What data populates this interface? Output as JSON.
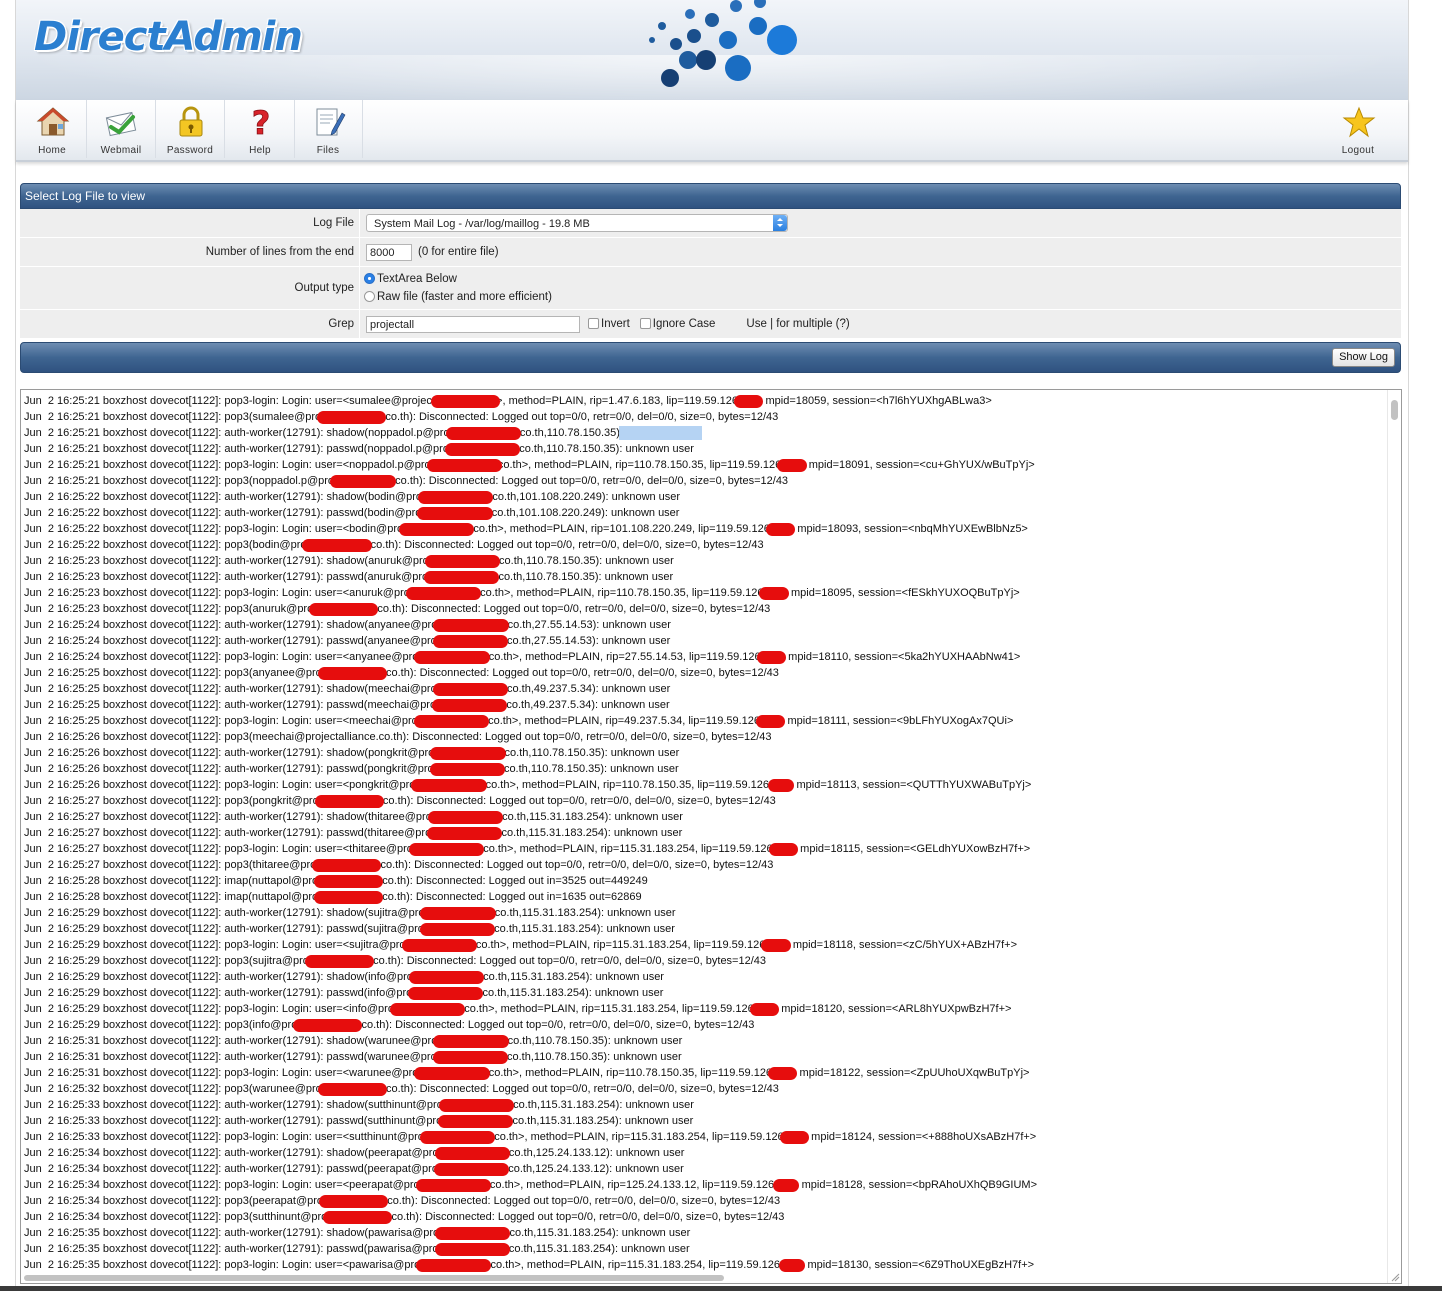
{
  "brand": {
    "logo_text": "DirectAdmin"
  },
  "toolbar": {
    "items": [
      {
        "label": "Home",
        "icon": "home-icon"
      },
      {
        "label": "Webmail",
        "icon": "webmail-icon"
      },
      {
        "label": "Password",
        "icon": "lock-icon"
      },
      {
        "label": "Help",
        "icon": "help-icon"
      },
      {
        "label": "Files",
        "icon": "files-icon"
      }
    ],
    "logout": {
      "label": "Logout",
      "icon": "star-icon"
    }
  },
  "form": {
    "title": "Select Log File to view",
    "log_file_label": "Log File",
    "log_file_value": "System Mail Log - /var/log/maillog - 19.8 MB",
    "lines_label": "Number of lines from the end",
    "lines_value": "8000",
    "lines_hint": "(0 for entire file)",
    "output_label": "Output type",
    "output_option_1": "TextArea Below",
    "output_option_2": "Raw file (faster and more efficient)",
    "output_selected": "TextArea Below",
    "grep_label": "Grep",
    "grep_value": "projectall",
    "invert_label": "Invert",
    "ignore_case_label": "Ignore Case",
    "grep_hint": "Use | for multiple (?)",
    "show_button": "Show Log"
  },
  "colors": {
    "accent_blue": "#3f6591",
    "redaction": "#e60d0d"
  },
  "log_lines": [
    "Jun  2 16:25:21 boxzhost dovecot[1122]: pop3-login: Login: user=<sumalee@project                    >, method=PLAIN, rip=1.47.6.183, lip=119.59.126       , mpid=18059, session=<h7l6hYUXhgABLwa3>",
    "Jun  2 16:25:21 boxzhost dovecot[1122]: pop3(sumalee@pro                    .co.th): Disconnected: Logged out top=0/0, retr=0/0, del=0/0, size=0, bytes=12/43",
    "Jun  2 16:25:21 boxzhost dovecot[1122]: auth-worker(12791): shadow(noppadol.p@pro                      .co.th,110.78.150.35): unknown user",
    "Jun  2 16:25:21 boxzhost dovecot[1122]: auth-worker(12791): passwd(noppadol.p@pro                      .co.th,110.78.150.35): unknown user",
    "Jun  2 16:25:21 boxzhost dovecot[1122]: pop3-login: Login: user=<noppadol.p@pro                      co.th>, method=PLAIN, rip=110.78.150.35, lip=119.59.126       , mpid=18091, session=<cu+GhYUX/wBuTpYj>",
    "Jun  2 16:25:21 boxzhost dovecot[1122]: pop3(noppadol.p@pro                   .co.th): Disconnected: Logged out top=0/0, retr=0/0, del=0/0, size=0, bytes=12/43",
    "Jun  2 16:25:22 boxzhost dovecot[1122]: auth-worker(12791): shadow(bodin@pro                      .co.th,101.108.220.249): unknown user",
    "Jun  2 16:25:22 boxzhost dovecot[1122]: auth-worker(12791): passwd(bodin@pro                      .co.th,101.108.220.249): unknown user",
    "Jun  2 16:25:22 boxzhost dovecot[1122]: pop3-login: Login: user=<bodin@pro                      .co.th>, method=PLAIN, rip=101.108.220.249, lip=119.59.126       , mpid=18093, session=<nbqMhYUXEwBlbNz5>",
    "Jun  2 16:25:22 boxzhost dovecot[1122]: pop3(bodin@pro                    .co.th): Disconnected: Logged out top=0/0, retr=0/0, del=0/0, size=0, bytes=12/43",
    "Jun  2 16:25:23 boxzhost dovecot[1122]: auth-worker(12791): shadow(anuruk@pro                      .co.th,110.78.150.35): unknown user",
    "Jun  2 16:25:23 boxzhost dovecot[1122]: auth-worker(12791): passwd(anuruk@pro                      .co.th,110.78.150.35): unknown user",
    "Jun  2 16:25:23 boxzhost dovecot[1122]: pop3-login: Login: user=<anuruk@pro                      .co.th>, method=PLAIN, rip=110.78.150.35, lip=119.59.126       , mpid=18095, session=<fESkhYUXOQBuTpYj>",
    "Jun  2 16:25:23 boxzhost dovecot[1122]: pop3(anuruk@pro                    .co.th): Disconnected: Logged out top=0/0, retr=0/0, del=0/0, size=0, bytes=12/43",
    "Jun  2 16:25:24 boxzhost dovecot[1122]: auth-worker(12791): shadow(anyanee@pro                      .co.th,27.55.14.53): unknown user",
    "Jun  2 16:25:24 boxzhost dovecot[1122]: auth-worker(12791): passwd(anyanee@pro                      .co.th,27.55.14.53): unknown user",
    "Jun  2 16:25:24 boxzhost dovecot[1122]: pop3-login: Login: user=<anyanee@pro                      .co.th>, method=PLAIN, rip=27.55.14.53, lip=119.59.126       , mpid=18110, session=<5ka2hYUXHAAbNw41>",
    "Jun  2 16:25:25 boxzhost dovecot[1122]: pop3(anyanee@pro                    .co.th): Disconnected: Logged out top=0/0, retr=0/0, del=0/0, size=0, bytes=12/43",
    "Jun  2 16:25:25 boxzhost dovecot[1122]: auth-worker(12791): shadow(meechai@pro                      .co.th,49.237.5.34): unknown user",
    "Jun  2 16:25:25 boxzhost dovecot[1122]: auth-worker(12791): passwd(meechai@pro                      .co.th,49.237.5.34): unknown user",
    "Jun  2 16:25:25 boxzhost dovecot[1122]: pop3-login: Login: user=<meechai@pro                      .co.th>, method=PLAIN, rip=49.237.5.34, lip=119.59.126       , mpid=18111, session=<9bLFhYUXogAx7QUi>",
    "Jun  2 16:25:26 boxzhost dovecot[1122]: pop3(meechai@projectalliance.co.th): Disconnected: Logged out top=0/0, retr=0/0, del=0/0, size=0, bytes=12/43",
    "Jun  2 16:25:26 boxzhost dovecot[1122]: auth-worker(12791): shadow(pongkrit@pro                      .co.th,110.78.150.35): unknown user",
    "Jun  2 16:25:26 boxzhost dovecot[1122]: auth-worker(12791): passwd(pongkrit@pro                      .co.th,110.78.150.35): unknown user",
    "Jun  2 16:25:26 boxzhost dovecot[1122]: pop3-login: Login: user=<pongkrit@pro                      .co.th>, method=PLAIN, rip=110.78.150.35, lip=119.59.126.      , mpid=18113, session=<QUTThYUXWABuTpYj>",
    "Jun  2 16:25:27 boxzhost dovecot[1122]: pop3(pongkrit@pro                    .co.th): Disconnected: Logged out top=0/0, retr=0/0, del=0/0, size=0, bytes=12/43",
    "Jun  2 16:25:27 boxzhost dovecot[1122]: auth-worker(12791): shadow(thitaree@pro                      .co.th,115.31.183.254): unknown user",
    "Jun  2 16:25:27 boxzhost dovecot[1122]: auth-worker(12791): passwd(thitaree@pro                      .co.th,115.31.183.254): unknown user",
    "Jun  2 16:25:27 boxzhost dovecot[1122]: pop3-login: Login: user=<thitaree@pro                      .co.th>, method=PLAIN, rip=115.31.183.254, lip=119.59.126       , mpid=18115, session=<GELdhYUXowBzH7f+>",
    "Jun  2 16:25:27 boxzhost dovecot[1122]: pop3(thitaree@pro                    .co.th): Disconnected: Logged out top=0/0, retr=0/0, del=0/0, size=0, bytes=12/43",
    "Jun  2 16:25:28 boxzhost dovecot[1122]: imap(nuttapol@pro                    .co.th): Disconnected: Logged out in=3525 out=449249",
    "Jun  2 16:25:28 boxzhost dovecot[1122]: imap(nuttapol@pro                    .co.th): Disconnected: Logged out in=1635 out=62869",
    "Jun  2 16:25:29 boxzhost dovecot[1122]: auth-worker(12791): shadow(sujitra@pro                      .co.th,115.31.183.254): unknown user",
    "Jun  2 16:25:29 boxzhost dovecot[1122]: auth-worker(12791): passwd(sujitra@pro                      .co.th,115.31.183.254): unknown user",
    "Jun  2 16:25:29 boxzhost dovecot[1122]: pop3-login: Login: user=<sujitra@pro                      .co.th>, method=PLAIN, rip=115.31.183.254, lip=119.59.126       , mpid=18118, session=<zC/5hYUX+ABzH7f+>",
    "Jun  2 16:25:29 boxzhost dovecot[1122]: pop3(sujitra@pro                    .co.th): Disconnected: Logged out top=0/0, retr=0/0, del=0/0, size=0, bytes=12/43",
    "Jun  2 16:25:29 boxzhost dovecot[1122]: auth-worker(12791): shadow(info@pro                      .co.th,115.31.183.254): unknown user",
    "Jun  2 16:25:29 boxzhost dovecot[1122]: auth-worker(12791): passwd(info@pro                      .co.th,115.31.183.254): unknown user",
    "Jun  2 16:25:29 boxzhost dovecot[1122]: pop3-login: Login: user=<info@pro                      .co.th>, method=PLAIN, rip=115.31.183.254, lip=119.59.126       , mpid=18120, session=<ARL8hYUXpwBzH7f+>",
    "Jun  2 16:25:29 boxzhost dovecot[1122]: pop3(info@pro                    .co.th): Disconnected: Logged out top=0/0, retr=0/0, del=0/0, size=0, bytes=12/43",
    "Jun  2 16:25:31 boxzhost dovecot[1122]: auth-worker(12791): shadow(warunee@pro                      .co.th,110.78.150.35): unknown user",
    "Jun  2 16:25:31 boxzhost dovecot[1122]: auth-worker(12791): passwd(warunee@pro                      .co.th,110.78.150.35): unknown user",
    "Jun  2 16:25:31 boxzhost dovecot[1122]: pop3-login: Login: user=<warunee@pro                      .co.th>, method=PLAIN, rip=110.78.150.35, lip=119.59.126       , mpid=18122, session=<ZpUUhoUXqwBuTpYj>",
    "Jun  2 16:25:32 boxzhost dovecot[1122]: pop3(warunee@pro                    .co.th): Disconnected: Logged out top=0/0, retr=0/0, del=0/0, size=0, bytes=12/43",
    "Jun  2 16:25:33 boxzhost dovecot[1122]: auth-worker(12791): shadow(sutthinunt@pro                      .co.th,115.31.183.254): unknown user",
    "Jun  2 16:25:33 boxzhost dovecot[1122]: auth-worker(12791): passwd(sutthinunt@pro                      .co.th,115.31.183.254): unknown user",
    "Jun  2 16:25:33 boxzhost dovecot[1122]: pop3-login: Login: user=<sutthinunt@pro                      .co.th>, method=PLAIN, rip=115.31.183.254, lip=119.59.126       , mpid=18124, session=<+888hoUXsABzH7f+>",
    "Jun  2 16:25:34 boxzhost dovecot[1122]: auth-worker(12791): shadow(peerapat@pro                      .co.th,125.24.133.12): unknown user",
    "Jun  2 16:25:34 boxzhost dovecot[1122]: auth-worker(12791): passwd(peerapat@pro                      .co.th,125.24.133.12): unknown user",
    "Jun  2 16:25:34 boxzhost dovecot[1122]: pop3-login: Login: user=<peerapat@pro                      .co.th>, method=PLAIN, rip=125.24.133.12, lip=119.59.126.      , mpid=18128, session=<bpRAhoUXhQB9GIUM>",
    "Jun  2 16:25:34 boxzhost dovecot[1122]: pop3(peerapat@pro                    .co.th): Disconnected: Logged out top=0/0, retr=0/0, del=0/0, size=0, bytes=12/43",
    "Jun  2 16:25:34 boxzhost dovecot[1122]: pop3(sutthinunt@pro                    .co.th): Disconnected: Logged out top=0/0, retr=0/0, del=0/0, size=0, bytes=12/43",
    "Jun  2 16:25:35 boxzhost dovecot[1122]: auth-worker(12791): shadow(pawarisa@pro                      .co.th,115.31.183.254): unknown user",
    "Jun  2 16:25:35 boxzhost dovecot[1122]: auth-worker(12791): passwd(pawarisa@pro                      .co.th,115.31.183.254): unknown user",
    "Jun  2 16:25:35 boxzhost dovecot[1122]: pop3-login: Login: user=<pawarisa@pro                      .co.th>, method=PLAIN, rip=115.31.183.254, lip=119.59.126.      , mpid=18130, session=<6Z9ThoUXEgBzH7f+>"
  ]
}
